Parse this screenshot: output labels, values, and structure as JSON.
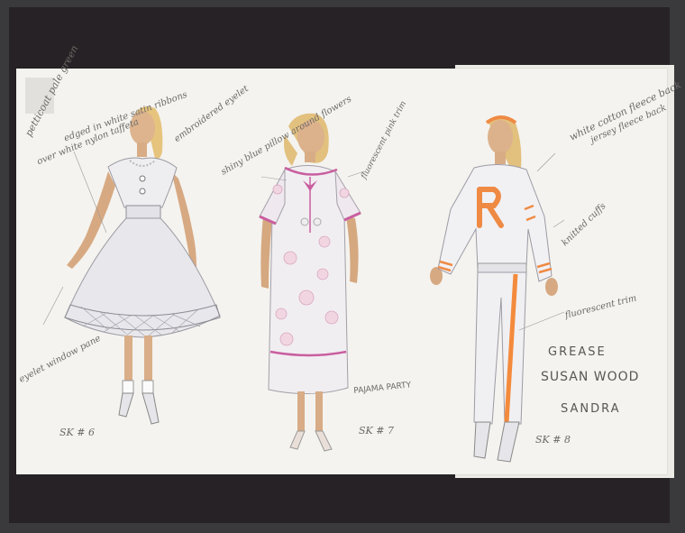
{
  "title_block": {
    "show": "GREASE",
    "designer": "SUSAN WOOD",
    "character": "SANDRA"
  },
  "sketches": [
    {
      "number": "SK # 6",
      "notes": {
        "petticoat": "petticoat pale green",
        "overlay": "over white nylon taffeta",
        "ribbons": "edged in white satin ribbons",
        "embroidery": "embroidered eyelet",
        "hem": "eyelet window pane"
      }
    },
    {
      "number": "SK # 7",
      "notes": {
        "print": "shiny blue pillow around flowers",
        "trim": "fluorescent pink trim",
        "caption": "PAJAMA PARTY"
      }
    },
    {
      "number": "SK # 8",
      "notes": {
        "material": "white cotton fleece back",
        "material_2": "jersey fleece back",
        "cuffs": "knitted cuffs",
        "trim": "fluorescent trim"
      }
    }
  ],
  "colors": {
    "paper": "#f4f3ef",
    "board": "#262225",
    "skin": "#d9b08a",
    "hair": "#e3c07a",
    "pink_trim": "#c65a9b",
    "orange": "#f2843a"
  }
}
